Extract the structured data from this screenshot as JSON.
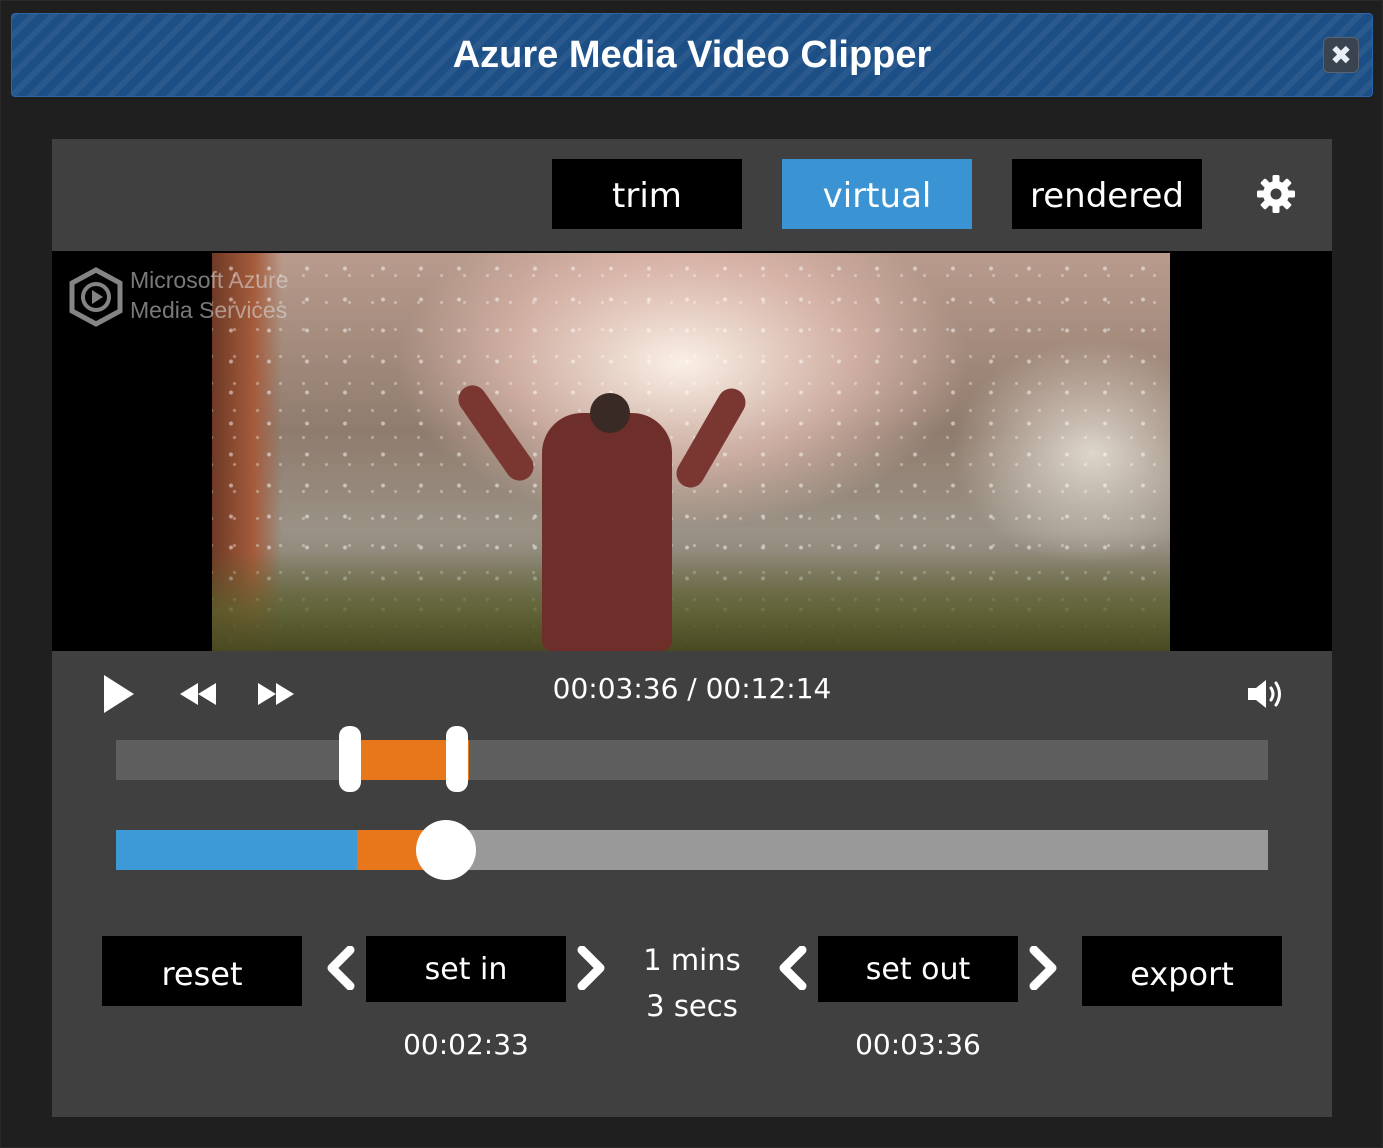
{
  "window": {
    "title": "Azure Media Video Clipper",
    "close_glyph": "✖"
  },
  "modes": {
    "trim": "trim",
    "virtual": "virtual",
    "rendered": "rendered",
    "active": "virtual"
  },
  "video": {
    "watermark_line1": "Microsoft Azure",
    "watermark_line2": "Media Services"
  },
  "player": {
    "time_display": "00:03:36 / 00:12:14",
    "playback_progress": 0.294,
    "clip_in_fraction": 0.208,
    "clip_out_fraction": 0.294
  },
  "clip": {
    "reset_label": "reset",
    "set_in_label": "set in",
    "set_out_label": "set out",
    "export_label": "export",
    "in_time": "00:02:33",
    "out_time": "00:03:36",
    "duration_mins": "1 mins",
    "duration_secs": "3 secs"
  },
  "icons": {
    "play": "play-icon",
    "rewind": "rewind-icon",
    "fast_forward": "fast-forward-icon",
    "volume": "volume-icon",
    "settings": "gear-icon",
    "prev": "chevron-left-icon",
    "next": "chevron-right-icon",
    "close": "close-icon"
  },
  "colors": {
    "titlebar": "#1d4f87",
    "active_mode": "#3a93d2",
    "clip_orange": "#e8761a",
    "played_blue": "#3d9ad6",
    "panel": "#404040"
  }
}
